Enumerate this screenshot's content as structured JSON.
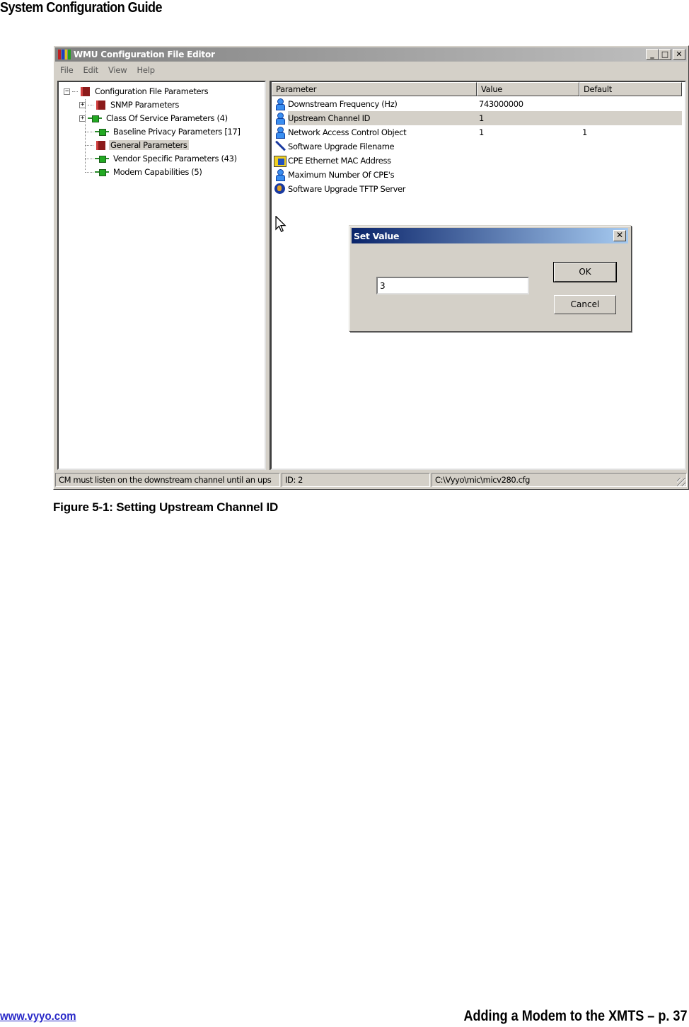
{
  "document": {
    "header_title": "System Configuration Guide",
    "figure_caption": "Figure 5-1: Setting Upstream Channel ID",
    "footer_link": "www.vyyo.com",
    "footer_page": "Adding a Modem to the XMTS – p. 37"
  },
  "window": {
    "title": "WMU Configuration File Editor",
    "title_buttons": {
      "minimize": "_",
      "maximize": "□",
      "close": "✕"
    },
    "menu": [
      "File",
      "Edit",
      "View",
      "Help"
    ]
  },
  "tree": {
    "items": [
      {
        "label": "Configuration File Parameters",
        "icon": "book-icon",
        "expander": "−",
        "level": 0
      },
      {
        "label": "SNMP Parameters",
        "icon": "book-icon",
        "expander": "+",
        "level": 1
      },
      {
        "label": "Class Of Service Parameters (4)",
        "icon": "node-icon",
        "expander": "+",
        "level": 1
      },
      {
        "label": "Baseline Privacy Parameters [17]",
        "icon": "node-icon",
        "expander": "",
        "level": 1
      },
      {
        "label": "General Parameters",
        "icon": "book-icon",
        "expander": "",
        "level": 1,
        "selected": true
      },
      {
        "label": "Vendor Specific Parameters (43)",
        "icon": "node-icon",
        "expander": "",
        "level": 1
      },
      {
        "label": "Modem Capabilities (5)",
        "icon": "node-icon",
        "expander": "",
        "level": 1
      }
    ]
  },
  "list": {
    "columns": [
      "Parameter",
      "Value",
      "Default"
    ],
    "rows": [
      {
        "name": "Downstream Frequency  (Hz)",
        "value": "743000000",
        "default": "",
        "icon": "person-icon"
      },
      {
        "name": "Upstream Channel ID",
        "value": "1",
        "default": "",
        "icon": "person-icon",
        "selected": true
      },
      {
        "name": "Network Access Control Object",
        "value": "1",
        "default": "1",
        "icon": "person-icon"
      },
      {
        "name": "Software Upgrade Filename",
        "value": "",
        "default": "",
        "icon": "pen-icon"
      },
      {
        "name": "CPE Ethernet MAC Address",
        "value": "",
        "default": "",
        "icon": "card-icon"
      },
      {
        "name": "Maximum Number Of CPE's",
        "value": "",
        "default": "",
        "icon": "person-icon"
      },
      {
        "name": "Software Upgrade TFTP Server",
        "value": "",
        "default": "",
        "icon": "globe-icon"
      }
    ]
  },
  "dialog": {
    "title": "Set Value",
    "close": "✕",
    "input_value": "3",
    "ok_label": "OK",
    "cancel_label": "Cancel"
  },
  "statusbar": {
    "message": "CM must listen on the downstream channel until an ups",
    "id": "ID: 2",
    "path": "C:\\Vyyo\\mic\\micv280.cfg"
  },
  "colors": {
    "window_bg": "#d4d0c8",
    "dialog_title_start": "#0a246a",
    "dialog_title_end": "#a6caf0",
    "link": "#2828c8"
  }
}
